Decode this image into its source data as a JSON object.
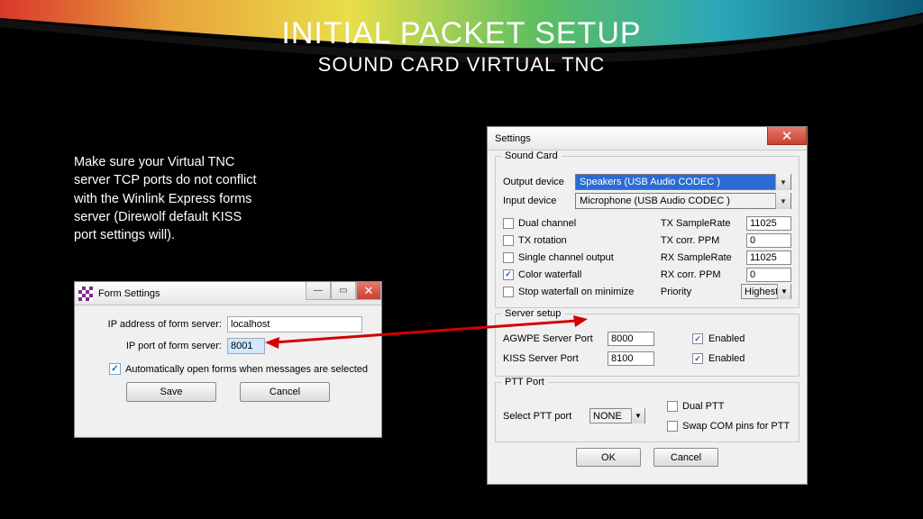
{
  "slide": {
    "title": "INITIAL PACKET SETUP",
    "subtitle": "SOUND CARD VIRTUAL TNC",
    "body": "Make sure your Virtual TNC server TCP ports do not conflict with the Winlink Express forms server (Direwolf default KISS port settings will)."
  },
  "formDialog": {
    "title": "Form Settings",
    "ipLabel": "IP address of form server:",
    "ipValue": "localhost",
    "portLabel": "IP port of form server:",
    "portValue": "8001",
    "autoOpenLabel": "Automatically open forms when messages are selected",
    "save": "Save",
    "cancel": "Cancel"
  },
  "settingsDialog": {
    "title": "Settings",
    "soundCard": {
      "caption": "Sound Card",
      "outputLabel": "Output device",
      "outputValue": "Speakers (USB Audio CODEC )",
      "inputLabel": "Input device",
      "inputValue": "Microphone (USB Audio CODEC )",
      "dualChannel": "Dual channel",
      "txRotation": "TX rotation",
      "singleChannel": "Single channel output",
      "colorWaterfall": "Color waterfall",
      "stopWaterfall": "Stop waterfall on minimize",
      "txSampleRateLabel": "TX SampleRate",
      "txSampleRate": "11025",
      "txCorrLabel": "TX corr. PPM",
      "txCorr": "0",
      "rxSampleRateLabel": "RX SampleRate",
      "rxSampleRate": "11025",
      "rxCorrLabel": "RX corr. PPM",
      "rxCorr": "0",
      "priorityLabel": "Priority",
      "priority": "Highest"
    },
    "server": {
      "caption": "Server setup",
      "agwpeLabel": "AGWPE Server Port",
      "agwpePort": "8000",
      "kissLabel": "KISS Server Port",
      "kissPort": "8100",
      "enabled": "Enabled"
    },
    "ptt": {
      "caption": "PTT Port",
      "selectLabel": "Select PTT port",
      "selectValue": "NONE",
      "dualPtt": "Dual PTT",
      "swapCom": "Swap COM pins for PTT"
    },
    "ok": "OK",
    "cancel": "Cancel"
  }
}
